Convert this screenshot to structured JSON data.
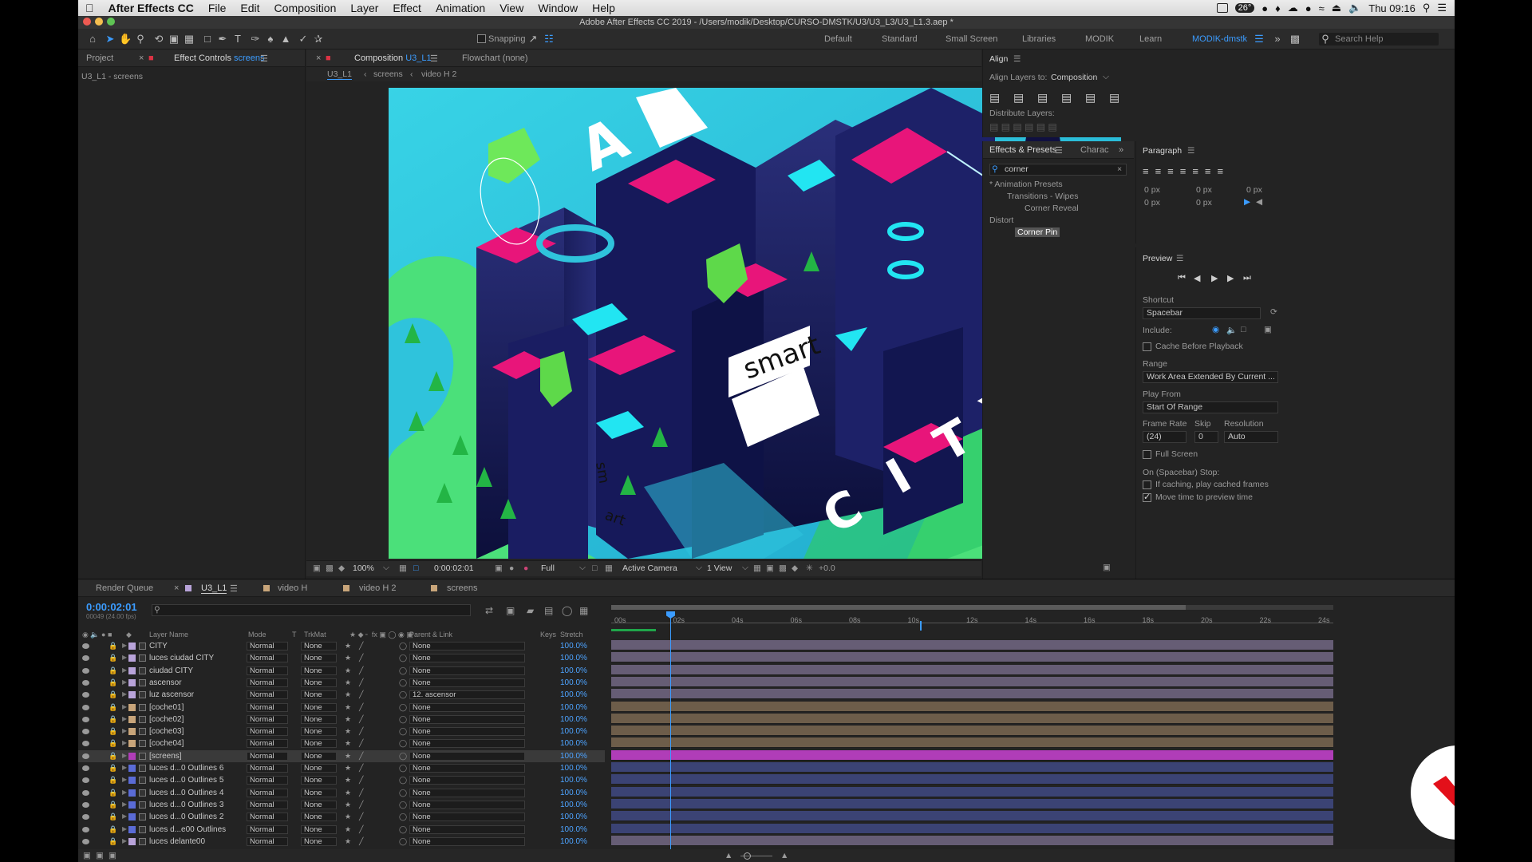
{
  "mac_menu": {
    "app": "After Effects CC",
    "items": [
      "File",
      "Edit",
      "Composition",
      "Layer",
      "Effect",
      "Animation",
      "View",
      "Window",
      "Help"
    ],
    "temperature": "26°",
    "clock": "Thu 09:16"
  },
  "window_title": "Adobe After Effects CC 2019 - /Users/modik/Desktop/CURSO-DMSTK/U3/U3_L3/U3_L1.3.aep *",
  "toolbar": {
    "snapping": "Snapping",
    "workspaces": [
      "Default",
      "Standard",
      "Small Screen",
      "Libraries",
      "MODIK",
      "Learn"
    ],
    "active_workspace": "MODIK-dmstk",
    "search_placeholder": "Search Help"
  },
  "project_panel": {
    "tab_project": "Project",
    "tab_effect_controls_prefix": "Effect Controls",
    "tab_effect_controls_layer": "screens",
    "breadcrumb": "U3_L1 - screens"
  },
  "comp_panel": {
    "tab_prefix": "Composition",
    "tab_comp": "U3_L1",
    "flowchart": "Flowchart (none)",
    "crumbs": [
      "U3_L1",
      "screens",
      "video H 2"
    ],
    "scene_text": {
      "smart": "smart",
      "city_letters": [
        "C",
        "I",
        "T",
        "Y"
      ],
      "big_a": "A",
      "sm": "sm",
      "art": "art"
    },
    "footer": {
      "zoom": "100%",
      "timecode": "0:00:02:01",
      "resolution": "Full",
      "camera": "Active Camera",
      "views": "1 View",
      "exposure": "+0.0"
    }
  },
  "align_panel": {
    "title": "Align",
    "align_to_label": "Align Layers to:",
    "align_to_value": "Composition",
    "distribute_label": "Distribute Layers:"
  },
  "effects_panel": {
    "tab": "Effects & Presets",
    "tab2": "Charac",
    "search": "corner",
    "tree": [
      {
        "label": "* Animation Presets",
        "level": 0
      },
      {
        "label": "Transitions - Wipes",
        "level": 1
      },
      {
        "label": "Corner Reveal",
        "level": 2
      },
      {
        "label": "Distort",
        "level": 0
      },
      {
        "label": "Corner Pin",
        "level": 1,
        "selected": true
      }
    ]
  },
  "paragraph_panel": {
    "title": "Paragraph",
    "values": [
      "0 px",
      "0 px",
      "0 px",
      "0 px",
      "0 px"
    ]
  },
  "preview_panel": {
    "title": "Preview",
    "shortcut_label": "Shortcut",
    "shortcut": "Spacebar",
    "include_label": "Include:",
    "cache_before": "Cache Before Playback",
    "range_label": "Range",
    "range": "Work Area Extended By Current ...",
    "play_from_label": "Play From",
    "play_from": "Start Of Range",
    "frame_rate_label": "Frame Rate",
    "skip_label": "Skip",
    "resolution_label": "Resolution",
    "frame_rate": "(24)",
    "skip": "0",
    "resolution": "Auto",
    "full_screen": "Full Screen",
    "on_stop_label": "On (Spacebar) Stop:",
    "if_caching": "If caching, play cached frames",
    "move_time": "Move time to preview time"
  },
  "timeline": {
    "tabs": [
      "Render Queue",
      "U3_L1",
      "video H",
      "video H 2",
      "screens"
    ],
    "timecode": "0:00:02:01",
    "fps": "00049 (24.00 fps)",
    "headers": {
      "layer_name": "Layer Name",
      "mode": "Mode",
      "t": "T",
      "trkmat": "TrkMat",
      "parent": "Parent & Link",
      "keys": "Keys",
      "stretch": "Stretch"
    },
    "ruler": [
      "00s",
      "02s",
      "04s",
      "06s",
      "08s",
      "10s",
      "12s",
      "14s",
      "16s",
      "18s",
      "20s",
      "22s",
      "24s"
    ],
    "layers": [
      {
        "name": "CITY",
        "mode": "Normal",
        "trkmat": "None",
        "parent": "None",
        "stretch": "100.0%",
        "color": "#b8a3d9",
        "kind": "comp"
      },
      {
        "name": "luces ciudad CITY",
        "mode": "Normal",
        "trkmat": "None",
        "parent": "None",
        "stretch": "100.0%",
        "color": "#b8a3d9",
        "kind": "comp"
      },
      {
        "name": "ciudad CITY",
        "mode": "Normal",
        "trkmat": "None",
        "parent": "None",
        "stretch": "100.0%",
        "color": "#b8a3d9",
        "kind": "comp"
      },
      {
        "name": "ascensor",
        "mode": "Normal",
        "trkmat": "None",
        "parent": "None",
        "stretch": "100.0%",
        "color": "#b8a3d9",
        "kind": "comp"
      },
      {
        "name": "luz ascensor",
        "mode": "Normal",
        "trkmat": "None",
        "parent": "12. ascensor",
        "stretch": "100.0%",
        "color": "#b8a3d9",
        "kind": "comp"
      },
      {
        "name": "[coche01]",
        "mode": "Normal",
        "trkmat": "None",
        "parent": "None",
        "stretch": "100.0%",
        "color": "#c8a57a",
        "kind": "footage"
      },
      {
        "name": "[coche02]",
        "mode": "Normal",
        "trkmat": "None",
        "parent": "None",
        "stretch": "100.0%",
        "color": "#c8a57a",
        "kind": "footage"
      },
      {
        "name": "[coche03]",
        "mode": "Normal",
        "trkmat": "None",
        "parent": "None",
        "stretch": "100.0%",
        "color": "#c8a57a",
        "kind": "footage"
      },
      {
        "name": "[coche04]",
        "mode": "Normal",
        "trkmat": "None",
        "parent": "None",
        "stretch": "100.0%",
        "color": "#c8a57a",
        "kind": "footage"
      },
      {
        "name": "[screens]",
        "mode": "Normal",
        "trkmat": "None",
        "parent": "None",
        "stretch": "100.0%",
        "color": "#b03db8",
        "kind": "footage",
        "selected": true
      },
      {
        "name": "luces d...0 Outlines 6",
        "mode": "Normal",
        "trkmat": "None",
        "parent": "None",
        "stretch": "100.0%",
        "color": "#5a6bd6",
        "kind": "shape"
      },
      {
        "name": "luces d...0 Outlines 5",
        "mode": "Normal",
        "trkmat": "None",
        "parent": "None",
        "stretch": "100.0%",
        "color": "#5a6bd6",
        "kind": "shape"
      },
      {
        "name": "luces d...0 Outlines 4",
        "mode": "Normal",
        "trkmat": "None",
        "parent": "None",
        "stretch": "100.0%",
        "color": "#5a6bd6",
        "kind": "shape"
      },
      {
        "name": "luces d...0 Outlines 3",
        "mode": "Normal",
        "trkmat": "None",
        "parent": "None",
        "stretch": "100.0%",
        "color": "#5a6bd6",
        "kind": "shape"
      },
      {
        "name": "luces d...0 Outlines 2",
        "mode": "Normal",
        "trkmat": "None",
        "parent": "None",
        "stretch": "100.0%",
        "color": "#5a6bd6",
        "kind": "shape"
      },
      {
        "name": "luces d...e00 Outlines",
        "mode": "Normal",
        "trkmat": "None",
        "parent": "None",
        "stretch": "100.0%",
        "color": "#5a6bd6",
        "kind": "shape"
      },
      {
        "name": "luces delante00",
        "mode": "Normal",
        "trkmat": "None",
        "parent": "None",
        "stretch": "100.0%",
        "color": "#b8a3d9",
        "kind": "comp"
      }
    ]
  }
}
